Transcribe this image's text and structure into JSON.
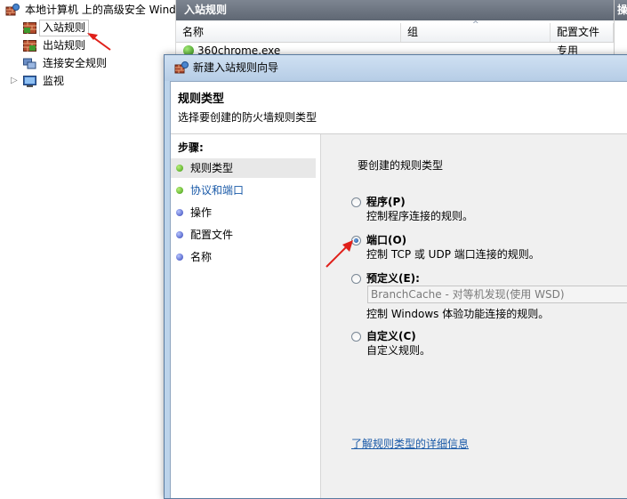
{
  "tree": {
    "root_label": "本地计算机 上的高级安全 Wind",
    "items": [
      {
        "label": "入站规则",
        "icon": "inbound-rules-icon"
      },
      {
        "label": "出站规则",
        "icon": "outbound-rules-icon"
      },
      {
        "label": "连接安全规则",
        "icon": "connection-security-icon"
      },
      {
        "label": "监视",
        "icon": "monitor-icon"
      }
    ]
  },
  "list": {
    "title": "入站规则",
    "columns": [
      "名称",
      "组",
      "配置文件"
    ],
    "rows": [
      {
        "name": "360chrome.exe",
        "profile": "专用"
      }
    ]
  },
  "actions": {
    "title": "操"
  },
  "wizard": {
    "title": "新建入站规则向导",
    "header_title": "规则类型",
    "header_subtitle": "选择要创建的防火墙规则类型",
    "steps_title": "步骤:",
    "steps": [
      "规则类型",
      "协议和端口",
      "操作",
      "配置文件",
      "名称"
    ],
    "question": "要创建的规则类型",
    "options": [
      {
        "title": "程序(P)",
        "desc": "控制程序连接的规则。",
        "selected": false
      },
      {
        "title": "端口(O)",
        "desc": "控制 TCP 或 UDP 端口连接的规则。",
        "selected": true
      },
      {
        "title": "预定义(E):",
        "desc": "控制 Windows 体验功能连接的规则。",
        "selected": false
      },
      {
        "title": "自定义(C)",
        "desc": "自定义规则。",
        "selected": false
      }
    ],
    "predefined_select": "BranchCache - 对等机发现(使用 WSD)",
    "help_link": "了解规则类型的详细信息"
  },
  "colors": {
    "accent_arrow": "#e0201a",
    "link": "#1a5aa8"
  }
}
